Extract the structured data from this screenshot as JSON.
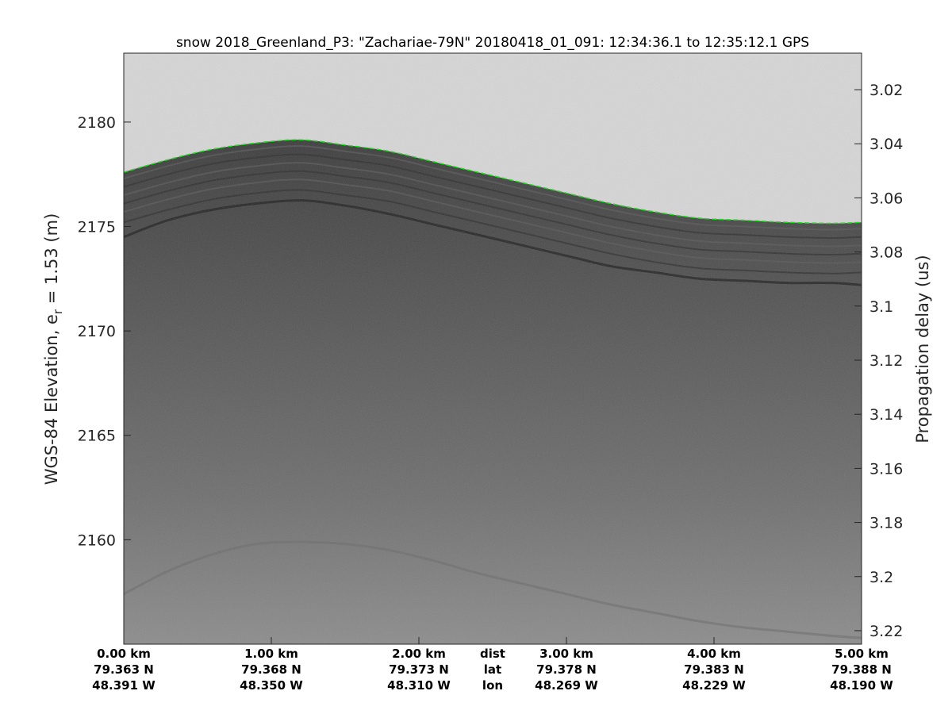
{
  "chart_data": {
    "type": "radargram",
    "title": "snow 2018_Greenland_P3: \"Zachariae-79N\"  20180418_01_091: 12:34:36.1 to 12:35:12.1 GPS",
    "ylabel_left": {
      "main": "WGS-84 Elevation, e",
      "subscript": "r",
      "suffix": " = 1.53 (m)"
    },
    "ylabel_right": "Propagation delay (us)",
    "left_axis": {
      "ylim": [
        2155,
        2183.3
      ],
      "ticks": [
        2180,
        2175,
        2170,
        2165,
        2160
      ]
    },
    "right_axis": {
      "ylim": [
        3.225,
        3.0065
      ],
      "ticks": [
        {
          "value": 3.02,
          "label": "3.02"
        },
        {
          "value": 3.04,
          "label": "3.04"
        },
        {
          "value": 3.06,
          "label": "3.06"
        },
        {
          "value": 3.08,
          "label": "3.08"
        },
        {
          "value": 3.1,
          "label": "3.1"
        },
        {
          "value": 3.12,
          "label": "3.12"
        },
        {
          "value": 3.14,
          "label": "3.14"
        },
        {
          "value": 3.16,
          "label": "3.16"
        },
        {
          "value": 3.18,
          "label": "3.18"
        },
        {
          "value": 3.2,
          "label": "3.2"
        },
        {
          "value": 3.22,
          "label": "3.22"
        }
      ]
    },
    "xlim_km": [
      0,
      5
    ],
    "x_columns": [
      {
        "km": 0,
        "dist": "0.00 km",
        "lat": "79.363 N",
        "lon": "48.391 W"
      },
      {
        "km": 1,
        "dist": "1.00 km",
        "lat": "79.368 N",
        "lon": "48.350 W"
      },
      {
        "km": 2,
        "dist": "2.00 km",
        "lat": "79.373 N",
        "lon": "48.310 W"
      },
      {
        "km": 3,
        "dist": "3.00 km",
        "lat": "79.378 N",
        "lon": "48.269 W"
      },
      {
        "km": 4,
        "dist": "4.00 km",
        "lat": "79.383 N",
        "lon": "48.229 W"
      },
      {
        "km": 5,
        "dist": "5.00 km",
        "lat": "79.388 N",
        "lon": "48.190 W"
      }
    ],
    "row_labels": {
      "dist": "dist",
      "lat": "lat",
      "lon": "lon"
    },
    "row_labels_position_km": 2.5,
    "surface_pick": {
      "color": "#22dd22",
      "points": [
        [
          0,
          2177.6
        ],
        [
          0.3,
          2178.2
        ],
        [
          0.6,
          2178.7
        ],
        [
          0.9,
          2179.0
        ],
        [
          1.2,
          2179.15
        ],
        [
          1.5,
          2178.9
        ],
        [
          1.8,
          2178.6
        ],
        [
          2.1,
          2178.1
        ],
        [
          2.4,
          2177.6
        ],
        [
          2.7,
          2177.1
        ],
        [
          3.0,
          2176.6
        ],
        [
          3.3,
          2176.1
        ],
        [
          3.6,
          2175.7
        ],
        [
          3.9,
          2175.4
        ],
        [
          4.2,
          2175.3
        ],
        [
          4.5,
          2175.2
        ],
        [
          4.8,
          2175.15
        ],
        [
          5.0,
          2175.2
        ]
      ]
    },
    "strong_layer_points": [
      [
        0,
        2174.5
      ],
      [
        0.3,
        2175.3
      ],
      [
        0.6,
        2175.8
      ],
      [
        0.9,
        2176.1
      ],
      [
        1.2,
        2176.25
      ],
      [
        1.5,
        2176.0
      ],
      [
        1.8,
        2175.6
      ],
      [
        2.1,
        2175.1
      ],
      [
        2.4,
        2174.6
      ],
      [
        2.7,
        2174.1
      ],
      [
        3.0,
        2173.6
      ],
      [
        3.3,
        2173.1
      ],
      [
        3.6,
        2172.8
      ],
      [
        3.9,
        2172.5
      ],
      [
        4.2,
        2172.4
      ],
      [
        4.5,
        2172.3
      ],
      [
        4.8,
        2172.3
      ],
      [
        5.0,
        2172.2
      ]
    ],
    "deep_layer_points": [
      [
        0,
        2157.4
      ],
      [
        0.3,
        2158.5
      ],
      [
        0.6,
        2159.3
      ],
      [
        0.9,
        2159.8
      ],
      [
        1.2,
        2159.9
      ],
      [
        1.5,
        2159.8
      ],
      [
        1.8,
        2159.5
      ],
      [
        2.1,
        2159.0
      ],
      [
        2.4,
        2158.4
      ],
      [
        2.7,
        2157.9
      ],
      [
        3.0,
        2157.4
      ],
      [
        3.3,
        2156.9
      ],
      [
        3.6,
        2156.5
      ],
      [
        3.9,
        2156.1
      ],
      [
        4.2,
        2155.8
      ],
      [
        4.5,
        2155.6
      ],
      [
        4.8,
        2155.4
      ],
      [
        5.0,
        2155.3
      ]
    ],
    "colors": {
      "air": "#d6d6d6",
      "firn_top": "#4a4a4a",
      "firn_bottom": "#8a8a8a",
      "pick": "#22dd22"
    }
  }
}
